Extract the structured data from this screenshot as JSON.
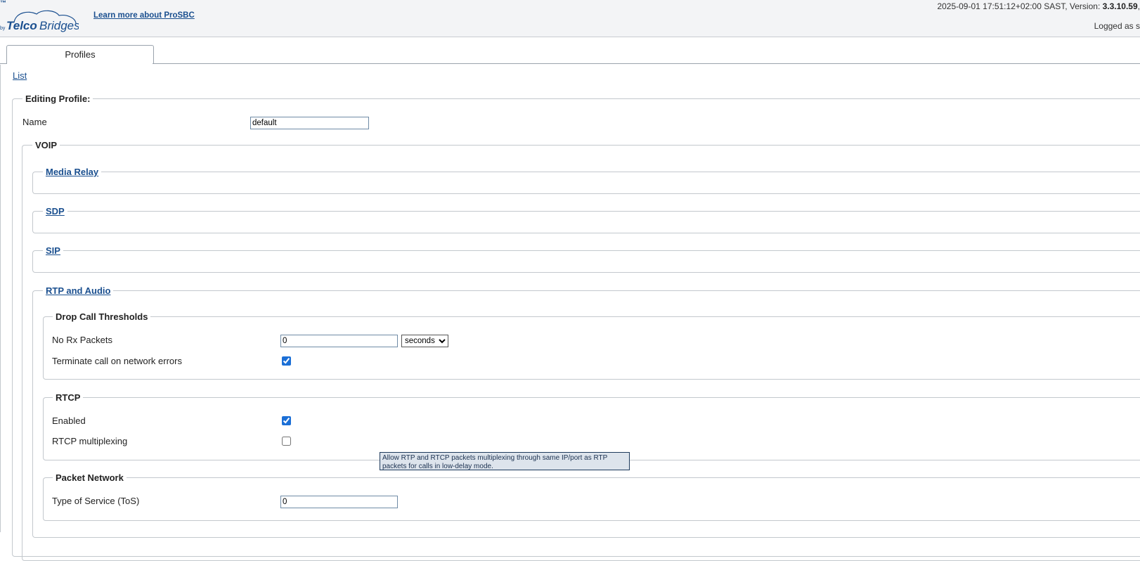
{
  "header": {
    "trademark": "™",
    "logo_text": "by TelcoBridges",
    "learn_more_link": "Learn more about ProSBC",
    "status_prefix": "2025-09-01 17:51:12+02:00 SAST, Version: ",
    "version": "3.3.10.59",
    "status_suffix": ",",
    "logged_as": "Logged as s"
  },
  "tabs": [
    {
      "label": "Profiles",
      "active": true
    }
  ],
  "nav": {
    "list_link": "List"
  },
  "form": {
    "title": "Editing Profile:",
    "name_label": "Name",
    "name_value": "default",
    "voip": {
      "title": "VOIP",
      "sections": {
        "media_relay": "Media Relay",
        "sdp": "SDP",
        "sip": "SIP",
        "rtp_audio": "RTP and Audio"
      },
      "drop_call": {
        "title": "Drop Call Thresholds",
        "no_rx_label": "No Rx Packets",
        "no_rx_value": "0",
        "unit_selected": "seconds",
        "terminate_label": "Terminate call on network errors",
        "terminate_checked": true
      },
      "rtcp": {
        "title": "RTCP",
        "enabled_label": "Enabled",
        "enabled_checked": true,
        "mux_label": "RTCP multiplexing",
        "mux_checked": false
      },
      "packet_network": {
        "title": "Packet Network",
        "tos_label": "Type of Service (ToS)",
        "tos_value": "0"
      }
    }
  },
  "tooltip": {
    "line1": "Allow RTP and RTCP packets multiplexing through same IP/port as RTP",
    "line2": "packets for calls in low-delay mode."
  },
  "colors": {
    "link": "#1a4f8f",
    "header_bg": "#f3f4f6",
    "border": "#c3c8cd",
    "tooltip_bg": "#dde4ec"
  }
}
